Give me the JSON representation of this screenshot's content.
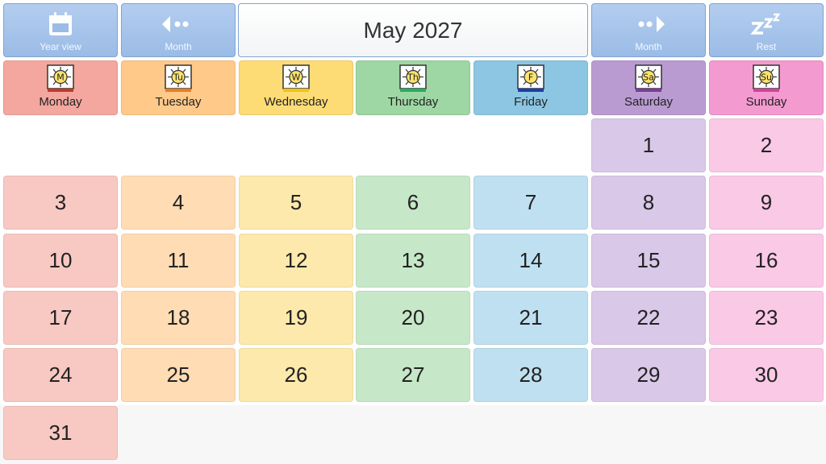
{
  "toolbar": {
    "year_view_label": "Year view",
    "prev_month_label": "Month",
    "next_month_label": "Month",
    "rest_label": "Rest"
  },
  "title": "May 2027",
  "days": [
    {
      "name": "Monday",
      "abbr": "M",
      "color": "#f3a79e",
      "cell": "#f8c8c2",
      "bar": "#c0392b"
    },
    {
      "name": "Tuesday",
      "abbr": "Tu",
      "color": "#ffc98a",
      "cell": "#ffdcb4",
      "bar": "#e67e22"
    },
    {
      "name": "Wednesday",
      "abbr": "W",
      "color": "#fddc75",
      "cell": "#fde9ac",
      "bar": "#f1c40f"
    },
    {
      "name": "Thursday",
      "abbr": "Th",
      "color": "#9ed7a3",
      "cell": "#c6e8c8",
      "bar": "#27ae60"
    },
    {
      "name": "Friday",
      "abbr": "F",
      "color": "#8cc6e3",
      "cell": "#bfe0f0",
      "bar": "#1a3fa8"
    },
    {
      "name": "Saturday",
      "abbr": "Sa",
      "color": "#b99bd1",
      "cell": "#d9c8e8",
      "bar": "#7d3c98"
    },
    {
      "name": "Sunday",
      "abbr": "Su",
      "color": "#f39ad0",
      "cell": "#f9c9e6",
      "bar": "#d63f9a"
    }
  ],
  "weeks": [
    [
      null,
      null,
      null,
      null,
      null,
      "1",
      "2"
    ],
    [
      "3",
      "4",
      "5",
      "6",
      "7",
      "8",
      "9"
    ],
    [
      "10",
      "11",
      "12",
      "13",
      "14",
      "15",
      "16"
    ],
    [
      "17",
      "18",
      "19",
      "20",
      "21",
      "22",
      "23"
    ],
    [
      "24",
      "25",
      "26",
      "27",
      "28",
      "29",
      "30"
    ],
    [
      "31",
      null,
      null,
      null,
      null,
      null,
      null
    ]
  ]
}
